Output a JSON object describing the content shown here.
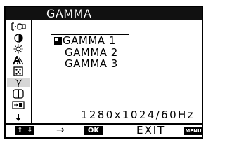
{
  "header": {
    "title": "GAMMA"
  },
  "sidebar": {
    "items": [
      {
        "icon": "input-icon"
      },
      {
        "icon": "contrast-icon"
      },
      {
        "icon": "brightness-icon"
      },
      {
        "icon": "sharpness-icon"
      },
      {
        "icon": "picture-mode-icon"
      },
      {
        "icon": "gamma-icon",
        "active": true
      },
      {
        "icon": "color-icon"
      },
      {
        "icon": "position-icon"
      },
      {
        "icon": "down-arrow-icon"
      }
    ]
  },
  "gamma_options": [
    {
      "label": "GAMMA 1",
      "selected": true
    },
    {
      "label": "GAMMA 2",
      "selected": false
    },
    {
      "label": "GAMMA 3",
      "selected": false
    }
  ],
  "status": {
    "resolution": "1280x1024/60Hz"
  },
  "footer": {
    "up_label": "⇧",
    "down_label": "⇩",
    "move_symbol": "→",
    "ok_label": "OK",
    "exit_label": "EXIT",
    "menu_label": "MENU"
  }
}
